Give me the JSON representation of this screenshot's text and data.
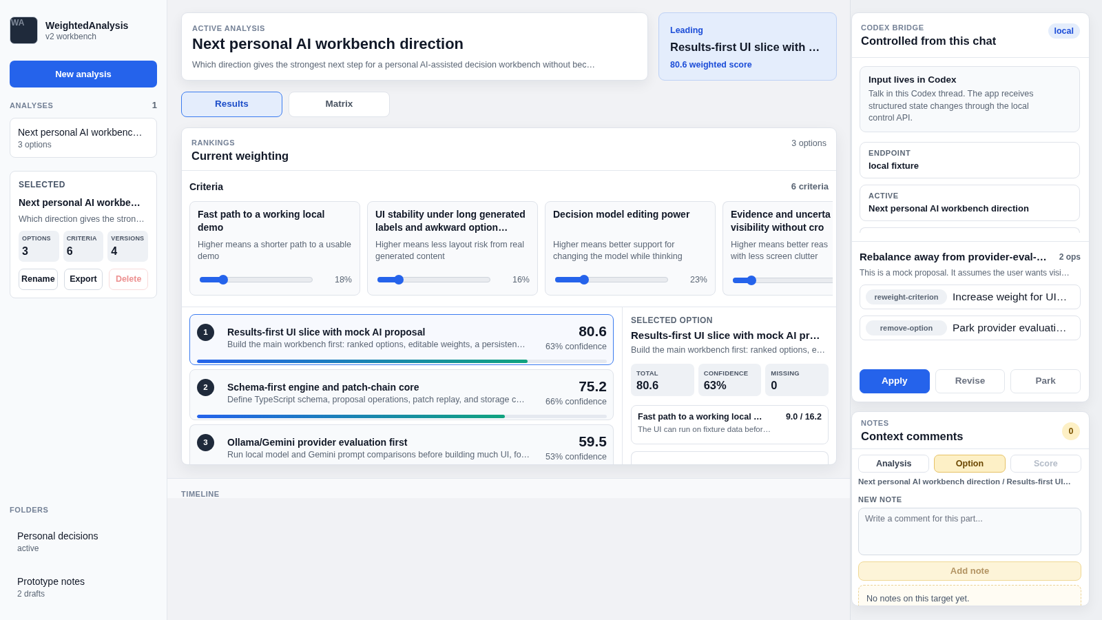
{
  "sidebar": {
    "logo": "WA",
    "app_name": "WeightedAnalysis",
    "app_subtitle": "v2 workbench",
    "new_button": "New analysis",
    "analyses_label": "ANALYSES",
    "analyses_count": "1",
    "analyses": [
      {
        "title": "Next personal AI workbenc…",
        "meta": "3 options"
      }
    ],
    "selected": {
      "label": "SELECTED",
      "title": "Next personal AI workbe…",
      "description": "Which direction gives the stron…",
      "stats": [
        {
          "label": "OPTIONS",
          "value": "3"
        },
        {
          "label": "CRITERIA",
          "value": "6"
        },
        {
          "label": "VERSIONS",
          "value": "4"
        }
      ],
      "actions": [
        {
          "label": "Rename",
          "kind": "default",
          "disabled": false
        },
        {
          "label": "Export",
          "kind": "default",
          "disabled": false
        },
        {
          "label": "Delete",
          "kind": "danger",
          "disabled": true
        }
      ]
    },
    "folders_label": "FOLDERS",
    "folders": [
      {
        "name": "Personal decisions",
        "meta": "active"
      },
      {
        "name": "Prototype notes",
        "meta": "2 drafts"
      }
    ]
  },
  "header": {
    "active_analysis": {
      "label": "ACTIVE ANALYSIS",
      "title": "Next personal AI workbench direction",
      "description": "Which direction gives the strongest next step for a personal AI-assisted decision workbench without bec…"
    },
    "leading": {
      "label": "Leading",
      "title": "Results-first UI slice with …",
      "score": "80.6 weighted score"
    }
  },
  "tabs": [
    {
      "label": "Results",
      "selected": true
    },
    {
      "label": "Matrix",
      "selected": false
    }
  ],
  "rankings": {
    "label": "RANKINGS",
    "title": "Current weighting",
    "count": "3 options",
    "criteria_title": "Criteria",
    "criteria_count": "6 criteria",
    "criteria": [
      {
        "title": "Fast path to a working local demo",
        "description": "Higher means a shorter path to a usable demo",
        "level": 0.18,
        "reading": "18%"
      },
      {
        "title": "UI stability under long generated labels and awkward option…",
        "description": "Higher means less layout risk from real generated content",
        "level": 0.16,
        "reading": "16%"
      },
      {
        "title": "Decision model editing power",
        "description": "Higher means better support for changing the model while thinking",
        "level": 0.23,
        "reading": "23%"
      },
      {
        "title": "Evidence and uncerta\nvisibility without cro",
        "description": "Higher means better reas\nwith less screen clutter",
        "level": 0.15
      }
    ],
    "options": [
      {
        "rank": "1",
        "title": "Results-first UI slice with mock AI proposal",
        "description": "Build the main workbench first: ranked options, editable weights, a persisten…",
        "score": "80.6",
        "confidence": "63% confidence",
        "level": 0.806,
        "selected": true
      },
      {
        "rank": "2",
        "title": "Schema-first engine and patch-chain core",
        "description": "Define TypeScript schema, proposal operations, patch replay, and storage c…",
        "score": "75.2",
        "confidence": "66% confidence",
        "level": 0.752,
        "selected": false
      },
      {
        "rank": "3",
        "title": "Ollama/Gemini provider evaluation first",
        "description": "Run local model and Gemini prompt comparisons before building much UI, fo…",
        "score": "59.5",
        "confidence": "53% confidence",
        "selected": false
      }
    ],
    "selected_option": {
      "label": "SELECTED OPTION",
      "title": "Results-first UI slice with mock AI pr…",
      "description": "Build the main workbench first: ranked options, e…",
      "stats": [
        {
          "label": "TOTAL",
          "value": "80.6"
        },
        {
          "label": "CONFIDENCE",
          "value": "63%"
        },
        {
          "label": "MISSING",
          "value": "0"
        }
      ],
      "breakdown": [
        {
          "title": "Fast path to a working local …",
          "score": "9.0 / 16.2",
          "note": "The UI can run on fixture data befor…"
        }
      ]
    }
  },
  "timeline": {
    "label": "TIMELINE"
  },
  "codex_bridge": {
    "label": "CODEX BRIDGE",
    "title": "Controlled from this chat",
    "badge": "local",
    "intro": {
      "title": "Input lives in Codex",
      "text": "Talk in this Codex thread. The app receives structured state changes through the local control API."
    },
    "fields": [
      {
        "label": "ENDPOINT",
        "value": "local fixture"
      },
      {
        "label": "ACTIVE",
        "value": "Next personal AI workbench direction"
      }
    ]
  },
  "proposal": {
    "title": "Rebalance away from provider-eval-…",
    "count": "2 ops",
    "summary": "This is a mock proposal. It assumes the user wants visi…",
    "operations": [
      {
        "tag": "reweight-criterion",
        "text": "Increase weight for UI…"
      },
      {
        "tag": "remove-option",
        "text": "Park provider evaluati…"
      }
    ],
    "actions": [
      {
        "label": "Apply",
        "kind": "primary"
      },
      {
        "label": "Revise",
        "kind": "secondary"
      },
      {
        "label": "Park",
        "kind": "secondary"
      }
    ]
  },
  "notes": {
    "label": "NOTES",
    "title": "Context comments",
    "count": "0",
    "targets": [
      {
        "label": "Analysis",
        "selected": false,
        "disabled": false
      },
      {
        "label": "Option",
        "selected": true,
        "disabled": false
      },
      {
        "label": "Score",
        "selected": false,
        "disabled": true
      }
    ],
    "path": "Next personal AI workbench direction / Results-first UI…",
    "new_note_label": "NEW NOTE",
    "placeholder": "Write a comment for this part...",
    "add_button": {
      "label": "Add note",
      "disabled": true
    },
    "empty": "No notes on this target yet."
  }
}
